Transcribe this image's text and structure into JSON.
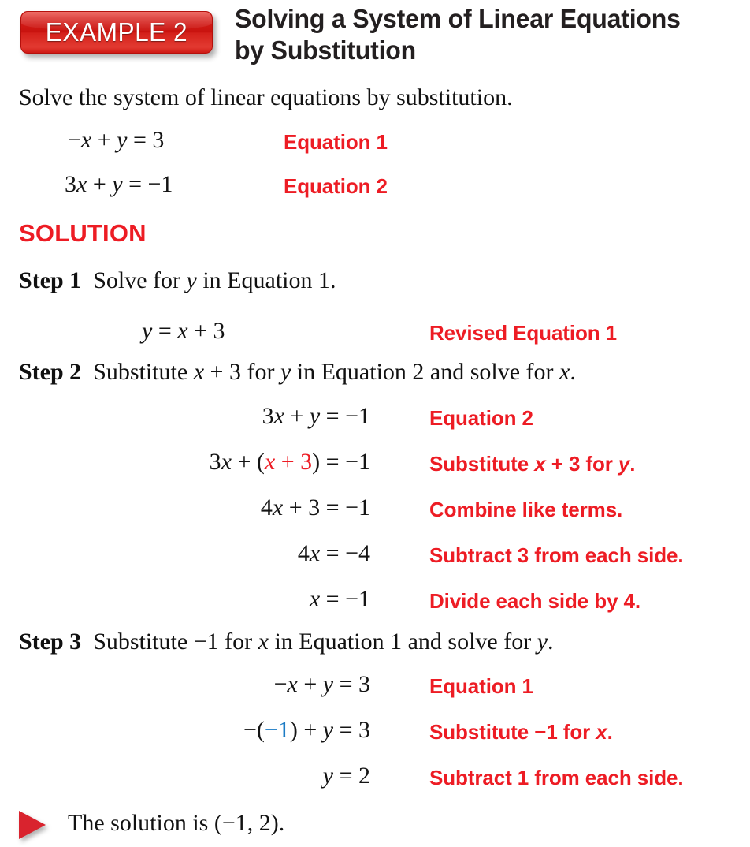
{
  "header": {
    "badge_label": "EXAMPLE 2",
    "title_line_1": "Solving a System of Linear Equations",
    "title_line_2": "by Substitution",
    "badge_color": "#d8201b",
    "title_color": "#231f20"
  },
  "colors": {
    "annotation_red": "#ed1c24",
    "highlight_blue": "#1c7bc4",
    "body_black": "#111111"
  },
  "intro": "Solve the system of linear equations by substitution.",
  "given_system": [
    {
      "equation": "−x + y = 3",
      "label": "Equation 1"
    },
    {
      "equation": "3x + y = −1",
      "label": "Equation 2"
    }
  ],
  "solution_heading": "SOLUTION",
  "steps": [
    {
      "number": "Step 1",
      "text": "Solve for y in Equation 1.",
      "lines": [
        {
          "equation": "y = x + 3",
          "label": "Revised Equation 1"
        }
      ]
    },
    {
      "number": "Step 2",
      "text": "Substitute x + 3 for y in Equation 2 and solve for x.",
      "lines": [
        {
          "equation": "3x + y = −1",
          "label": "Equation 2"
        },
        {
          "equation": "3x + (x + 3) = −1",
          "label": "Substitute x + 3 for y.",
          "highlight": "x + 3",
          "highlight_color": "#ed1c24"
        },
        {
          "equation": "4x + 3 = −1",
          "label": "Combine like terms."
        },
        {
          "equation": "4x = −4",
          "label": "Subtract 3 from each side."
        },
        {
          "equation": "x = −1",
          "label": "Divide each side by 4."
        }
      ]
    },
    {
      "number": "Step 3",
      "text": "Substitute −1 for x in Equation 1 and solve for y.",
      "lines": [
        {
          "equation": "−x + y = 3",
          "label": "Equation 1"
        },
        {
          "equation": "−(−1) + y = 3",
          "label": "Substitute −1 for x.",
          "highlight": "−1",
          "highlight_color": "#1c7bc4"
        },
        {
          "equation": "y = 2",
          "label": "Subtract 1 from each side."
        }
      ]
    }
  ],
  "final": {
    "marker": "triangle-right",
    "text": "The solution is (−1, 2)."
  }
}
